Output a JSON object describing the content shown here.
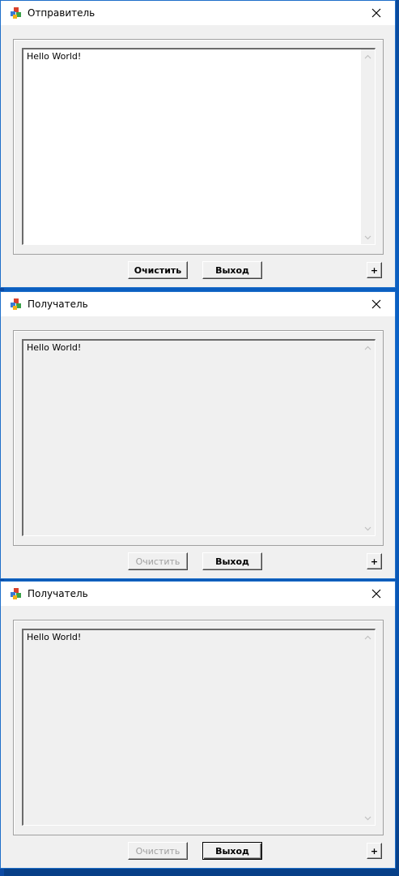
{
  "windows": [
    {
      "title": "Отправитель",
      "memo_text": "Hello World!",
      "memo_enabled": true,
      "clear_label": "Очистить",
      "clear_enabled": true,
      "exit_label": "Выход",
      "exit_default": false,
      "plus_label": "+"
    },
    {
      "title": "Получатель",
      "memo_text": "Hello World!",
      "memo_enabled": false,
      "clear_label": "Очистить",
      "clear_enabled": false,
      "exit_label": "Выход",
      "exit_default": false,
      "plus_label": "+"
    },
    {
      "title": "Получатель",
      "memo_text": "Hello World!",
      "memo_enabled": false,
      "clear_label": "Очистить",
      "clear_enabled": false,
      "exit_label": "Выход",
      "exit_default": true,
      "plus_label": "+"
    }
  ],
  "icons": {
    "app": "app-icon",
    "close": "close-icon",
    "scroll_up": "chevron-up-icon",
    "scroll_down": "chevron-down-icon"
  },
  "colors": {
    "desktop": "#0b63c8",
    "window_bg": "#f0f0f0",
    "titlebar_bg": "#ffffff",
    "disabled_text": "#a0a0a0"
  }
}
